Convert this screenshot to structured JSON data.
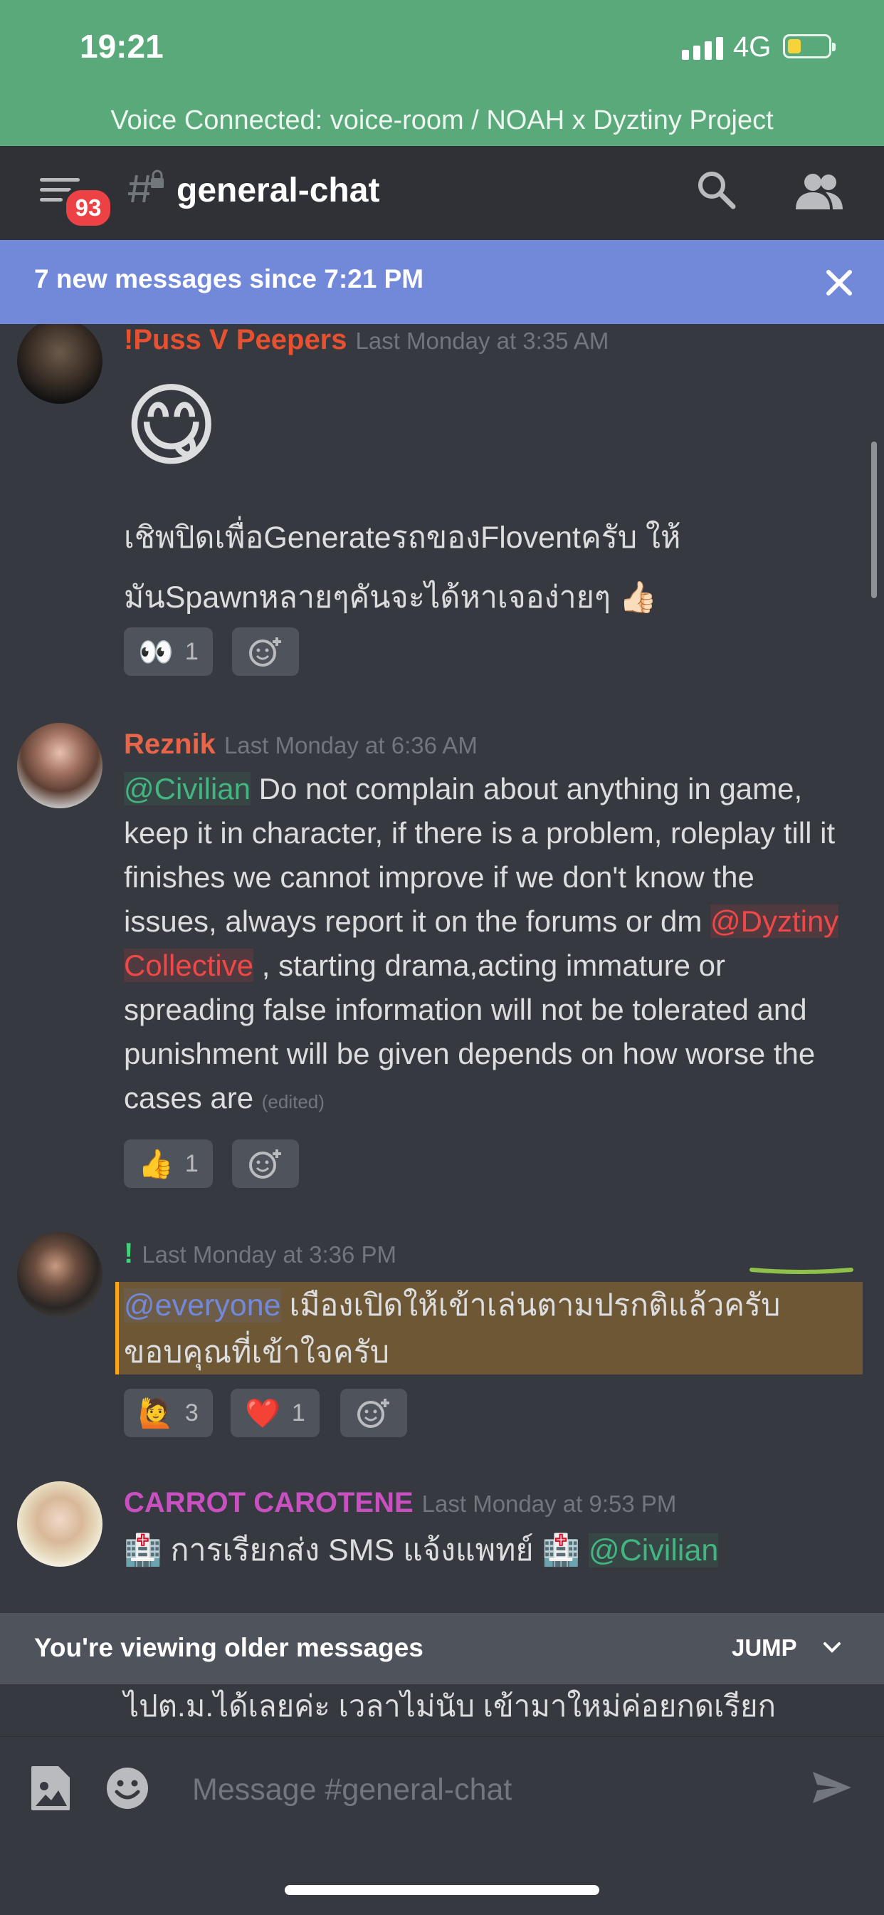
{
  "status_bar": {
    "time": "19:21",
    "network": "4G"
  },
  "voice_banner": {
    "text": "Voice Connected: voice-room / NOAH x Dyztiny Project"
  },
  "header": {
    "badge_count": "93",
    "channel_name": "general-chat"
  },
  "new_messages_banner": {
    "text": "7 new messages since 7:21 PM"
  },
  "messages": [
    {
      "author": "!Puss V Peepers",
      "author_color": "#e8512f",
      "timestamp": "Last Monday at 3:35 AM",
      "emoji": "😋",
      "text_line1": "เชิพปิดเพื่อGenerateรถของFloventครับ ให้",
      "text_line2": "มันSpawnหลายๆคันจะได้หาเจอง่ายๆ 👍🏻",
      "reactions": [
        {
          "emoji": "👀",
          "count": "1"
        }
      ]
    },
    {
      "author": "Reznik",
      "author_color": "#e8654a",
      "timestamp": "Last Monday at 6:36 AM",
      "mention1": "@Civilian",
      "text_a": " Do not complain about anything in game, keep it in character, if there is a problem, roleplay till it finishes we cannot improve if we don't know the issues, always report it on the forums or dm ",
      "mention2": "@Dyztiny Collective",
      "text_b": " , starting drama,acting immature or spreading false information will not be tolerated and punishment will be given depends on how worse the cases are",
      "edited": "(edited)",
      "reactions": [
        {
          "emoji": "👍",
          "count": "1"
        }
      ]
    },
    {
      "author": "!",
      "author_color": "#43d17a",
      "timestamp": "Last Monday at 3:36 PM",
      "mention": "@everyone",
      "text_line1": " เมืองเปิดให้เข้าเล่นตามปรกติแล้วครับ",
      "text_line2": "ขอบคุณที่เข้าใจครับ",
      "reactions": [
        {
          "emoji": "🙋",
          "count": "3"
        },
        {
          "emoji": "❤️",
          "count": "1"
        }
      ]
    },
    {
      "author": "CARROT CAROTENE",
      "author_color": "#c850c0",
      "timestamp": "Last Monday at 9:53 PM",
      "text": "🏥 การเรียกส่ง SMS แจ้งแพทย์ 🏥 ",
      "mention": "@Civilian"
    }
  ],
  "older_banner": {
    "text": "You're viewing older messages",
    "jump_label": "JUMP"
  },
  "partial_message": "ไปต.ม.ได้เลยค่ะ เวลาไม่นับ เข้ามาใหม่ค่อยกดเรียก",
  "composer": {
    "placeholder": "Message #general-chat"
  },
  "colors": {
    "accent": "#7289da",
    "voice_green": "#5aa97a",
    "badge_red": "#ed4245"
  }
}
